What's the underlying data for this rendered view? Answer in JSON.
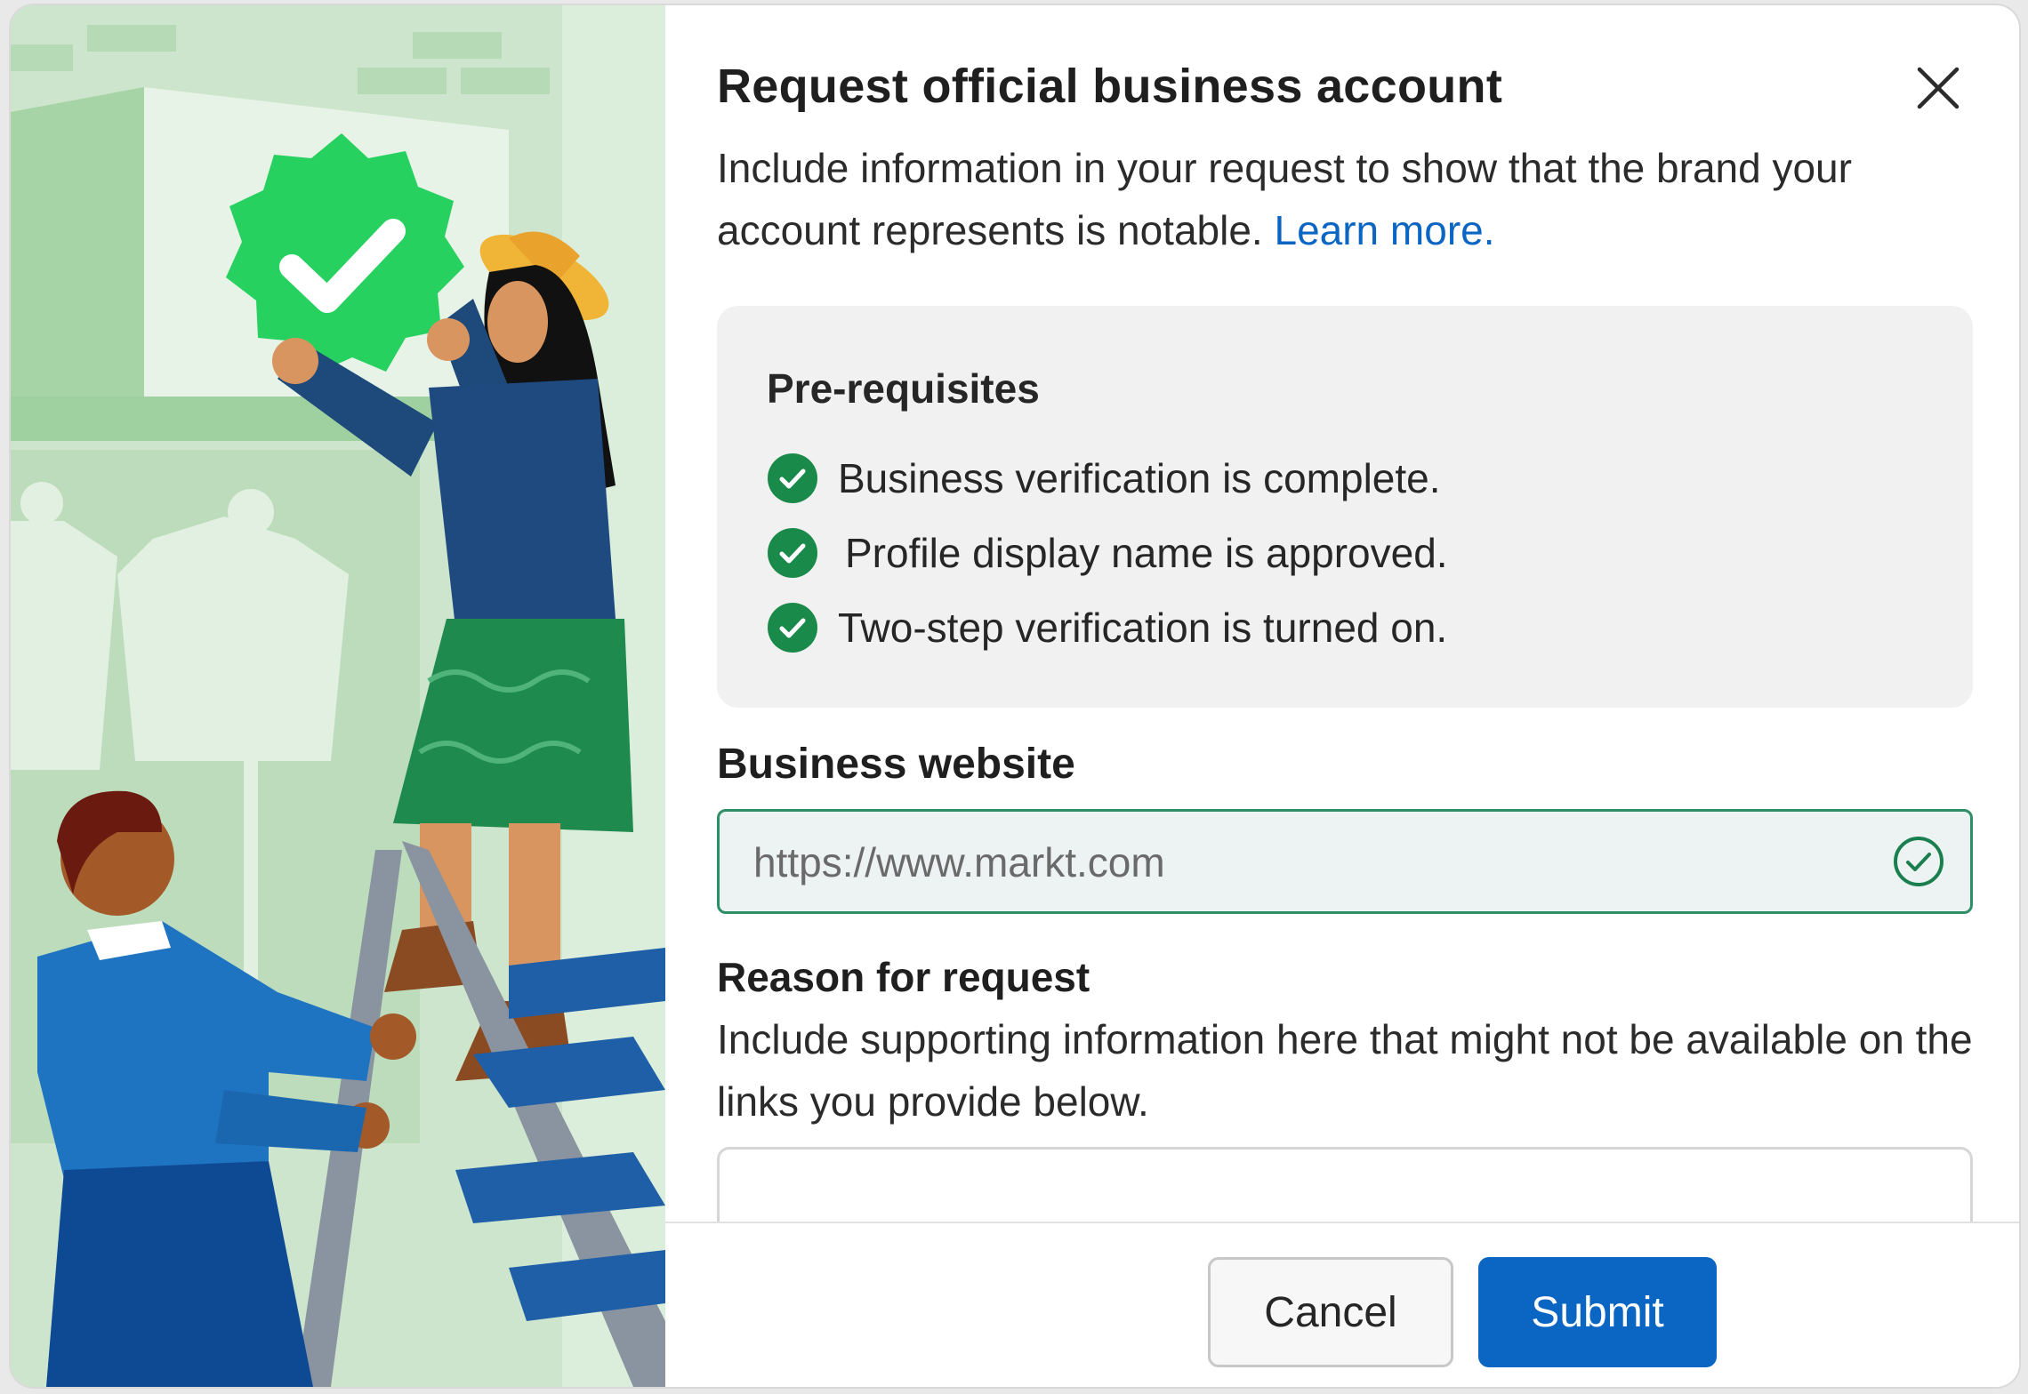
{
  "dialog": {
    "title": "Request official business account",
    "description": "Include information in your request to show that the brand your account represents is notable.",
    "learn_more": "Learn more.",
    "close_icon": "close-icon"
  },
  "prerequisites": {
    "title": "Pre-requisites",
    "items": [
      {
        "label": "Business verification is complete.",
        "icon": "check-circle-icon"
      },
      {
        "label": "Profile display name is approved.",
        "icon": "check-circle-icon"
      },
      {
        "label": "Two-step verification is turned on.",
        "icon": "check-circle-icon"
      }
    ]
  },
  "website": {
    "label": "Business website",
    "placeholder": "https://www.markt.com",
    "status_icon": "valid-check-icon"
  },
  "reason": {
    "label": "Reason for request",
    "help": "Include supporting information here that might not be available on the links you provide below.",
    "value": ""
  },
  "footer": {
    "cancel_label": "Cancel",
    "submit_label": "Submit"
  },
  "colors": {
    "accent": "#0a66c2",
    "success": "#1a8a4a",
    "input_valid_border": "#2e8f67",
    "badge_green": "#27d15f"
  }
}
